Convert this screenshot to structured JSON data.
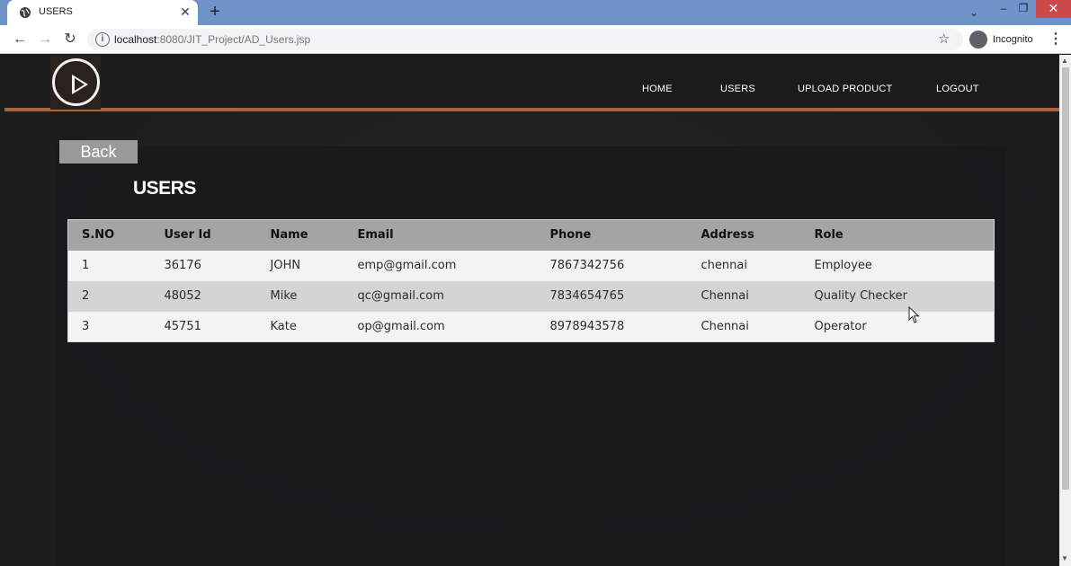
{
  "browser": {
    "tab_title": "USERS",
    "url_host": "localhost",
    "url_rest": ":8080/JIT_Project/AD_Users.jsp",
    "profile_label": "Incognito"
  },
  "site": {
    "nav": [
      "HOME",
      "USERS",
      "UPLOAD PRODUCT",
      "LOGOUT"
    ],
    "back_label": "Back",
    "page_title": "USERS"
  },
  "table": {
    "headers": [
      "S.NO",
      "User Id",
      "Name",
      "Email",
      "Phone",
      "Address",
      "Role"
    ],
    "rows": [
      [
        "1",
        "36176",
        "JOHN",
        "emp@gmail.com",
        "7867342756",
        "chennai",
        "Employee"
      ],
      [
        "2",
        "48052",
        "Mike",
        "qc@gmail.com",
        "7834654765",
        "Chennai",
        "Quality Checker"
      ],
      [
        "3",
        "45751",
        "Kate",
        "op@gmail.com",
        "8978943578",
        "Chennai",
        "Operator"
      ]
    ]
  },
  "colors": {
    "accent_line": "#a9643a",
    "tabstrip": "#6f94c9",
    "table_header": "#a4a4a4"
  }
}
